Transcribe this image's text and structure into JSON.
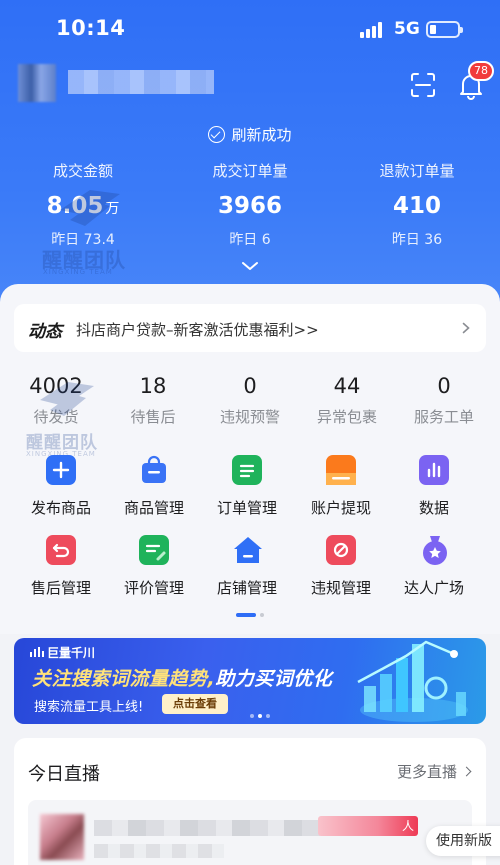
{
  "status_bar": {
    "time": "10:14",
    "network": "5G"
  },
  "header": {
    "notification_count": "78",
    "refresh_text": "刷新成功"
  },
  "stats": [
    {
      "label": "成交金额",
      "value": "8.05",
      "unit": "万",
      "yesterday": "昨日 73.4"
    },
    {
      "label": "成交订单量",
      "value": "3966",
      "unit": "",
      "yesterday": "昨日 6"
    },
    {
      "label": "退款订单量",
      "value": "410",
      "unit": "",
      "yesterday": "昨日 36"
    }
  ],
  "watermark": {
    "title": "醒醒团队",
    "subtitle": "XINGXING TEAM"
  },
  "news": {
    "tag": "动态",
    "text": "抖店商户贷款–新客激活优惠福利>>"
  },
  "counts": [
    {
      "value": "4002",
      "label": "待发货"
    },
    {
      "value": "18",
      "label": "待售后"
    },
    {
      "value": "0",
      "label": "违规预警"
    },
    {
      "value": "44",
      "label": "异常包裹"
    },
    {
      "value": "0",
      "label": "服务工单"
    }
  ],
  "shortcuts": [
    {
      "label": "发布商品",
      "icon": "plus-icon",
      "color": "#2f6ff6"
    },
    {
      "label": "商品管理",
      "icon": "bag-icon",
      "color": "#3a73f6"
    },
    {
      "label": "订单管理",
      "icon": "order-icon",
      "color": "#1fb35b"
    },
    {
      "label": "账户提现",
      "icon": "wallet-icon",
      "color": "#fb7a1c"
    },
    {
      "label": "数据",
      "icon": "chart-icon",
      "color": "#7b63f2"
    },
    {
      "label": "售后管理",
      "icon": "return-icon",
      "color": "#ee4b5c"
    },
    {
      "label": "评价管理",
      "icon": "review-icon",
      "color": "#1fb35b"
    },
    {
      "label": "店铺管理",
      "icon": "store-icon",
      "color": "#2f6ff6"
    },
    {
      "label": "违规管理",
      "icon": "violation-icon",
      "color": "#ee4b5c"
    },
    {
      "label": "达人广场",
      "icon": "star-badge-icon",
      "color": "#7b63f2"
    }
  ],
  "banner": {
    "brand": "巨量千川",
    "headline_a": "关注搜索词流量趋势,",
    "headline_b": "助力买词优化",
    "sub": "搜索流量工具上线!",
    "button": "点击查看"
  },
  "live": {
    "title": "今日直播",
    "more": "更多直播",
    "tag_text": "人"
  },
  "floating": {
    "new_version": "使用新版"
  }
}
